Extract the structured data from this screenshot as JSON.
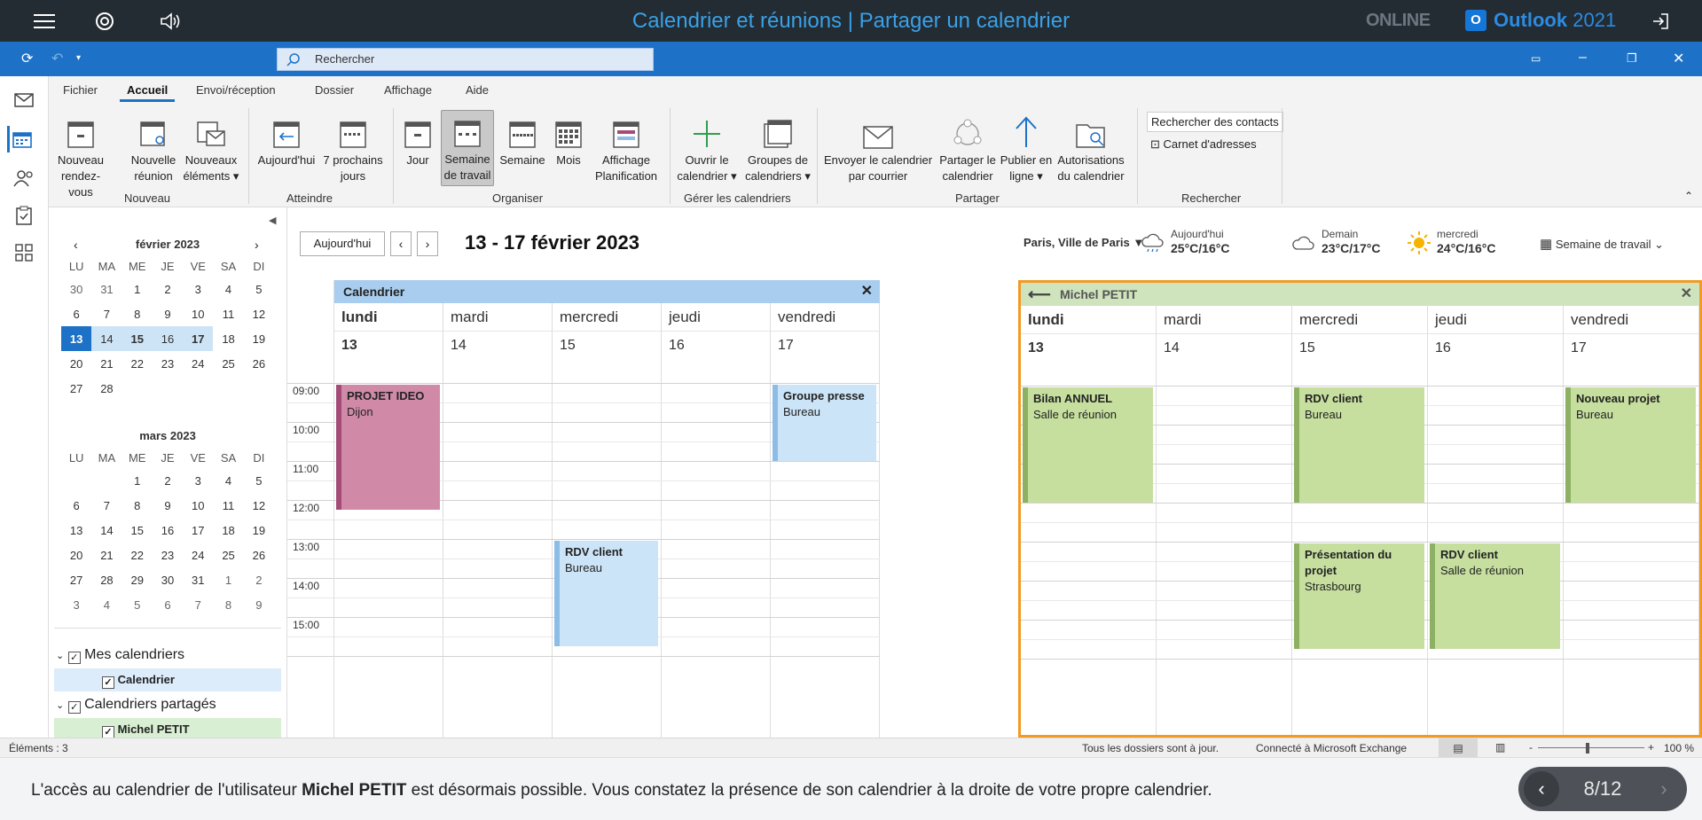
{
  "topbar": {
    "title": "Calendrier et réunions | Partager un calendrier",
    "brand1": "ONLINE",
    "brand2": "Outlook",
    "brand_year": "2021",
    "menu_icon": "hamburger-icon",
    "support_icon": "lifebuoy-icon",
    "sound_icon": "speaker-icon",
    "exit_icon": "exit-icon"
  },
  "search": {
    "placeholder": "Rechercher"
  },
  "tabs": [
    "Fichier",
    "Accueil",
    "Envoi/réception",
    "Dossier",
    "Affichage",
    "Aide"
  ],
  "ribbon": {
    "nouveau": [
      "Nouveau",
      "rendez-vous"
    ],
    "nreunion": [
      "Nouvelle",
      "réunion"
    ],
    "nelem": [
      "Nouveaux",
      "éléments ▾"
    ],
    "today": [
      "Aujourd'hui",
      ""
    ],
    "next7": [
      "7 prochains",
      "jours"
    ],
    "jour": [
      "Jour",
      ""
    ],
    "semtravail": [
      "Semaine",
      "de travail"
    ],
    "semaine": [
      "Semaine",
      ""
    ],
    "mois": [
      "Mois",
      ""
    ],
    "planif": [
      "Affichage",
      "Planification"
    ],
    "ouvrir": [
      "Ouvrir le",
      "calendrier ▾"
    ],
    "groupes": [
      "Groupes de",
      "calendriers ▾"
    ],
    "envoyer": [
      "Envoyer le calendrier",
      "par courrier"
    ],
    "partager": [
      "Partager le",
      "calendrier"
    ],
    "publier": [
      "Publier en",
      "ligne ▾"
    ],
    "autoris": [
      "Autorisations",
      "du calendrier"
    ],
    "rech_contacts": "Rechercher des contacts",
    "carnet": "Carnet d'adresses",
    "groups": {
      "nouveau": "Nouveau",
      "atteindre": "Atteindre",
      "organiser": "Organiser",
      "gerer": "Gérer les calendriers",
      "partager": "Partager",
      "rechercher": "Rechercher"
    }
  },
  "minical": {
    "dow": [
      "LU",
      "MA",
      "ME",
      "JE",
      "VE",
      "SA",
      "DI"
    ],
    "feb": {
      "title": "février 2023",
      "weeks": [
        [
          "30",
          "31",
          "1",
          "2",
          "3",
          "4",
          "5"
        ],
        [
          "6",
          "7",
          "8",
          "9",
          "10",
          "11",
          "12"
        ],
        [
          "13",
          "14",
          "15",
          "16",
          "17",
          "18",
          "19"
        ],
        [
          "20",
          "21",
          "22",
          "23",
          "24",
          "25",
          "26"
        ],
        [
          "27",
          "28",
          "",
          "",
          "",
          "",
          ""
        ]
      ]
    },
    "mar": {
      "title": "mars 2023",
      "weeks": [
        [
          "",
          "",
          "1",
          "2",
          "3",
          "4",
          "5"
        ],
        [
          "6",
          "7",
          "8",
          "9",
          "10",
          "11",
          "12"
        ],
        [
          "13",
          "14",
          "15",
          "16",
          "17",
          "18",
          "19"
        ],
        [
          "20",
          "21",
          "22",
          "23",
          "24",
          "25",
          "26"
        ],
        [
          "27",
          "28",
          "29",
          "30",
          "31",
          "1",
          "2"
        ],
        [
          "3",
          "4",
          "5",
          "6",
          "7",
          "8",
          "9"
        ]
      ]
    }
  },
  "calendars": {
    "mine": "Mes calendriers",
    "mine_item": "Calendrier",
    "shared": "Calendriers partagés",
    "shared_item": "Michel PETIT"
  },
  "header": {
    "today_btn": "Aujourd'hui",
    "range": "13 - 17 février 2023",
    "location": "Paris, Ville de Paris",
    "view": "Semaine de travail",
    "weather": [
      {
        "day": "Aujourd'hui",
        "temp": "25°C/16°C",
        "icon": "rain-cloud-icon"
      },
      {
        "day": "Demain",
        "temp": "23°C/17°C",
        "icon": "cloud-icon"
      },
      {
        "day": "mercredi",
        "temp": "24°C/16°C",
        "icon": "sun-icon"
      }
    ]
  },
  "days": [
    "lundi",
    "mardi",
    "mercredi",
    "jeudi",
    "vendredi"
  ],
  "daynums": [
    "13",
    "14",
    "15",
    "16",
    "17"
  ],
  "times": [
    "09:00",
    "10:00",
    "11:00",
    "12:00",
    "13:00",
    "14:00",
    "15:00"
  ],
  "panel1": {
    "title": "Calendrier",
    "color": "#a9cdee",
    "appts": [
      {
        "title": "PROJET IDEO",
        "loc": "Dijon",
        "day": 0,
        "start": 9,
        "end": 12.25,
        "color": "pink"
      },
      {
        "title": "Groupe presse",
        "loc": "Bureau",
        "day": 4,
        "start": 9,
        "end": 11,
        "color": "lblue"
      },
      {
        "title": "RDV client",
        "loc": "Bureau",
        "day": 2,
        "start": 13,
        "end": 15.75,
        "color": "lblue"
      }
    ]
  },
  "panel2": {
    "title": "Michel PETIT",
    "color": "#cfe4bd",
    "appts": [
      {
        "title": "Bilan ANNUEL",
        "loc": "Salle de réunion",
        "day": 0,
        "start": 9,
        "end": 12,
        "color": "green"
      },
      {
        "title": "RDV client",
        "loc": "Bureau",
        "day": 2,
        "start": 9,
        "end": 12,
        "color": "green"
      },
      {
        "title": "Nouveau projet",
        "loc": "Bureau",
        "day": 4,
        "start": 9,
        "end": 12,
        "color": "green"
      },
      {
        "title": "Présentation du projet",
        "loc": "Strasbourg",
        "day": 2,
        "start": 13,
        "end": 15.75,
        "color": "green"
      },
      {
        "title": "RDV client",
        "loc": "Salle de réunion",
        "day": 3,
        "start": 13,
        "end": 15.75,
        "color": "green"
      }
    ]
  },
  "status": {
    "items": "Éléments : 3",
    "sync": "Tous les dossiers sont à jour.",
    "conn": "Connecté à Microsoft Exchange",
    "zoom": "100 %"
  },
  "bottom": {
    "text_pre": "L'accès au calendrier de l'utilisateur ",
    "text_bold": "Michel PETIT",
    "text_post": " est désormais possible. Vous constatez la présence de son calendrier à la droite de votre propre calendrier.",
    "page": "8/12"
  }
}
